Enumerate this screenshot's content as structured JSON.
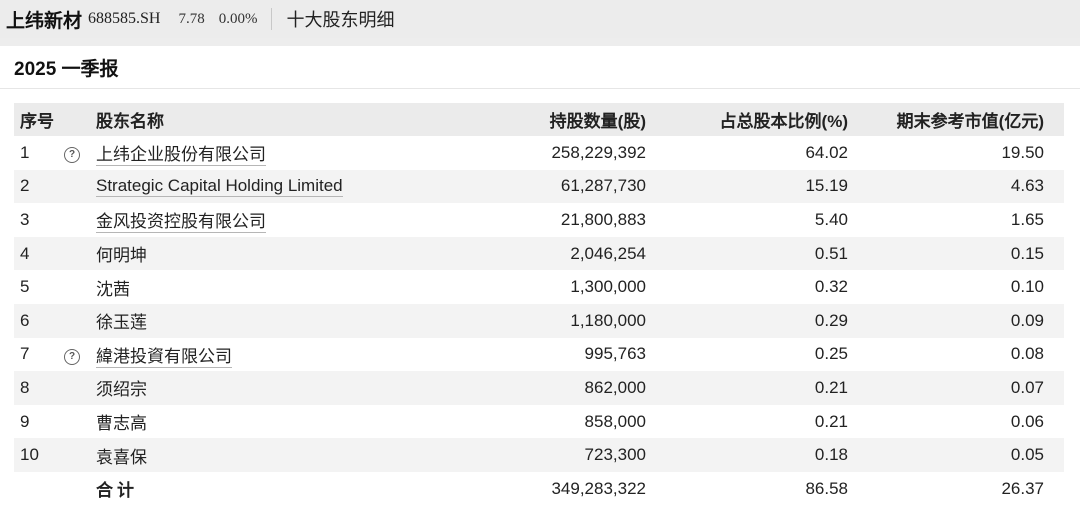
{
  "header": {
    "stock_name": "上纬新材",
    "stock_code": "688585.SH",
    "price": "7.78",
    "change_pct": "0.00%",
    "section_title": "十大股东明细"
  },
  "period": "2025 一季报",
  "table": {
    "columns": [
      "序号",
      "股东名称",
      "持股数量(股)",
      "占总股本比例(%)",
      "期末参考市值(亿元)"
    ],
    "rows": [
      {
        "idx": "1",
        "help": true,
        "name": "上纬企业股份有限公司",
        "linked": true,
        "shares": "258,229,392",
        "ratio": "64.02",
        "value": "19.50"
      },
      {
        "idx": "2",
        "help": false,
        "name": "Strategic Capital Holding Limited",
        "linked": true,
        "shares": "61,287,730",
        "ratio": "15.19",
        "value": "4.63"
      },
      {
        "idx": "3",
        "help": false,
        "name": "金风投资控股有限公司",
        "linked": true,
        "shares": "21,800,883",
        "ratio": "5.40",
        "value": "1.65"
      },
      {
        "idx": "4",
        "help": false,
        "name": "何明坤",
        "linked": false,
        "shares": "2,046,254",
        "ratio": "0.51",
        "value": "0.15"
      },
      {
        "idx": "5",
        "help": false,
        "name": "沈茜",
        "linked": false,
        "shares": "1,300,000",
        "ratio": "0.32",
        "value": "0.10"
      },
      {
        "idx": "6",
        "help": false,
        "name": "徐玉莲",
        "linked": false,
        "shares": "1,180,000",
        "ratio": "0.29",
        "value": "0.09"
      },
      {
        "idx": "7",
        "help": true,
        "name": "緯港投資有限公司",
        "linked": true,
        "shares": "995,763",
        "ratio": "0.25",
        "value": "0.08"
      },
      {
        "idx": "8",
        "help": false,
        "name": "须绍宗",
        "linked": false,
        "shares": "862,000",
        "ratio": "0.21",
        "value": "0.07"
      },
      {
        "idx": "9",
        "help": false,
        "name": "曹志高",
        "linked": false,
        "shares": "858,000",
        "ratio": "0.21",
        "value": "0.06"
      },
      {
        "idx": "10",
        "help": false,
        "name": "袁喜保",
        "linked": false,
        "shares": "723,300",
        "ratio": "0.18",
        "value": "0.05"
      }
    ],
    "total": {
      "label": "合计",
      "shares": "349,283,322",
      "ratio": "86.58",
      "value": "26.37"
    }
  },
  "icons": {
    "help": "question-circle-icon"
  }
}
